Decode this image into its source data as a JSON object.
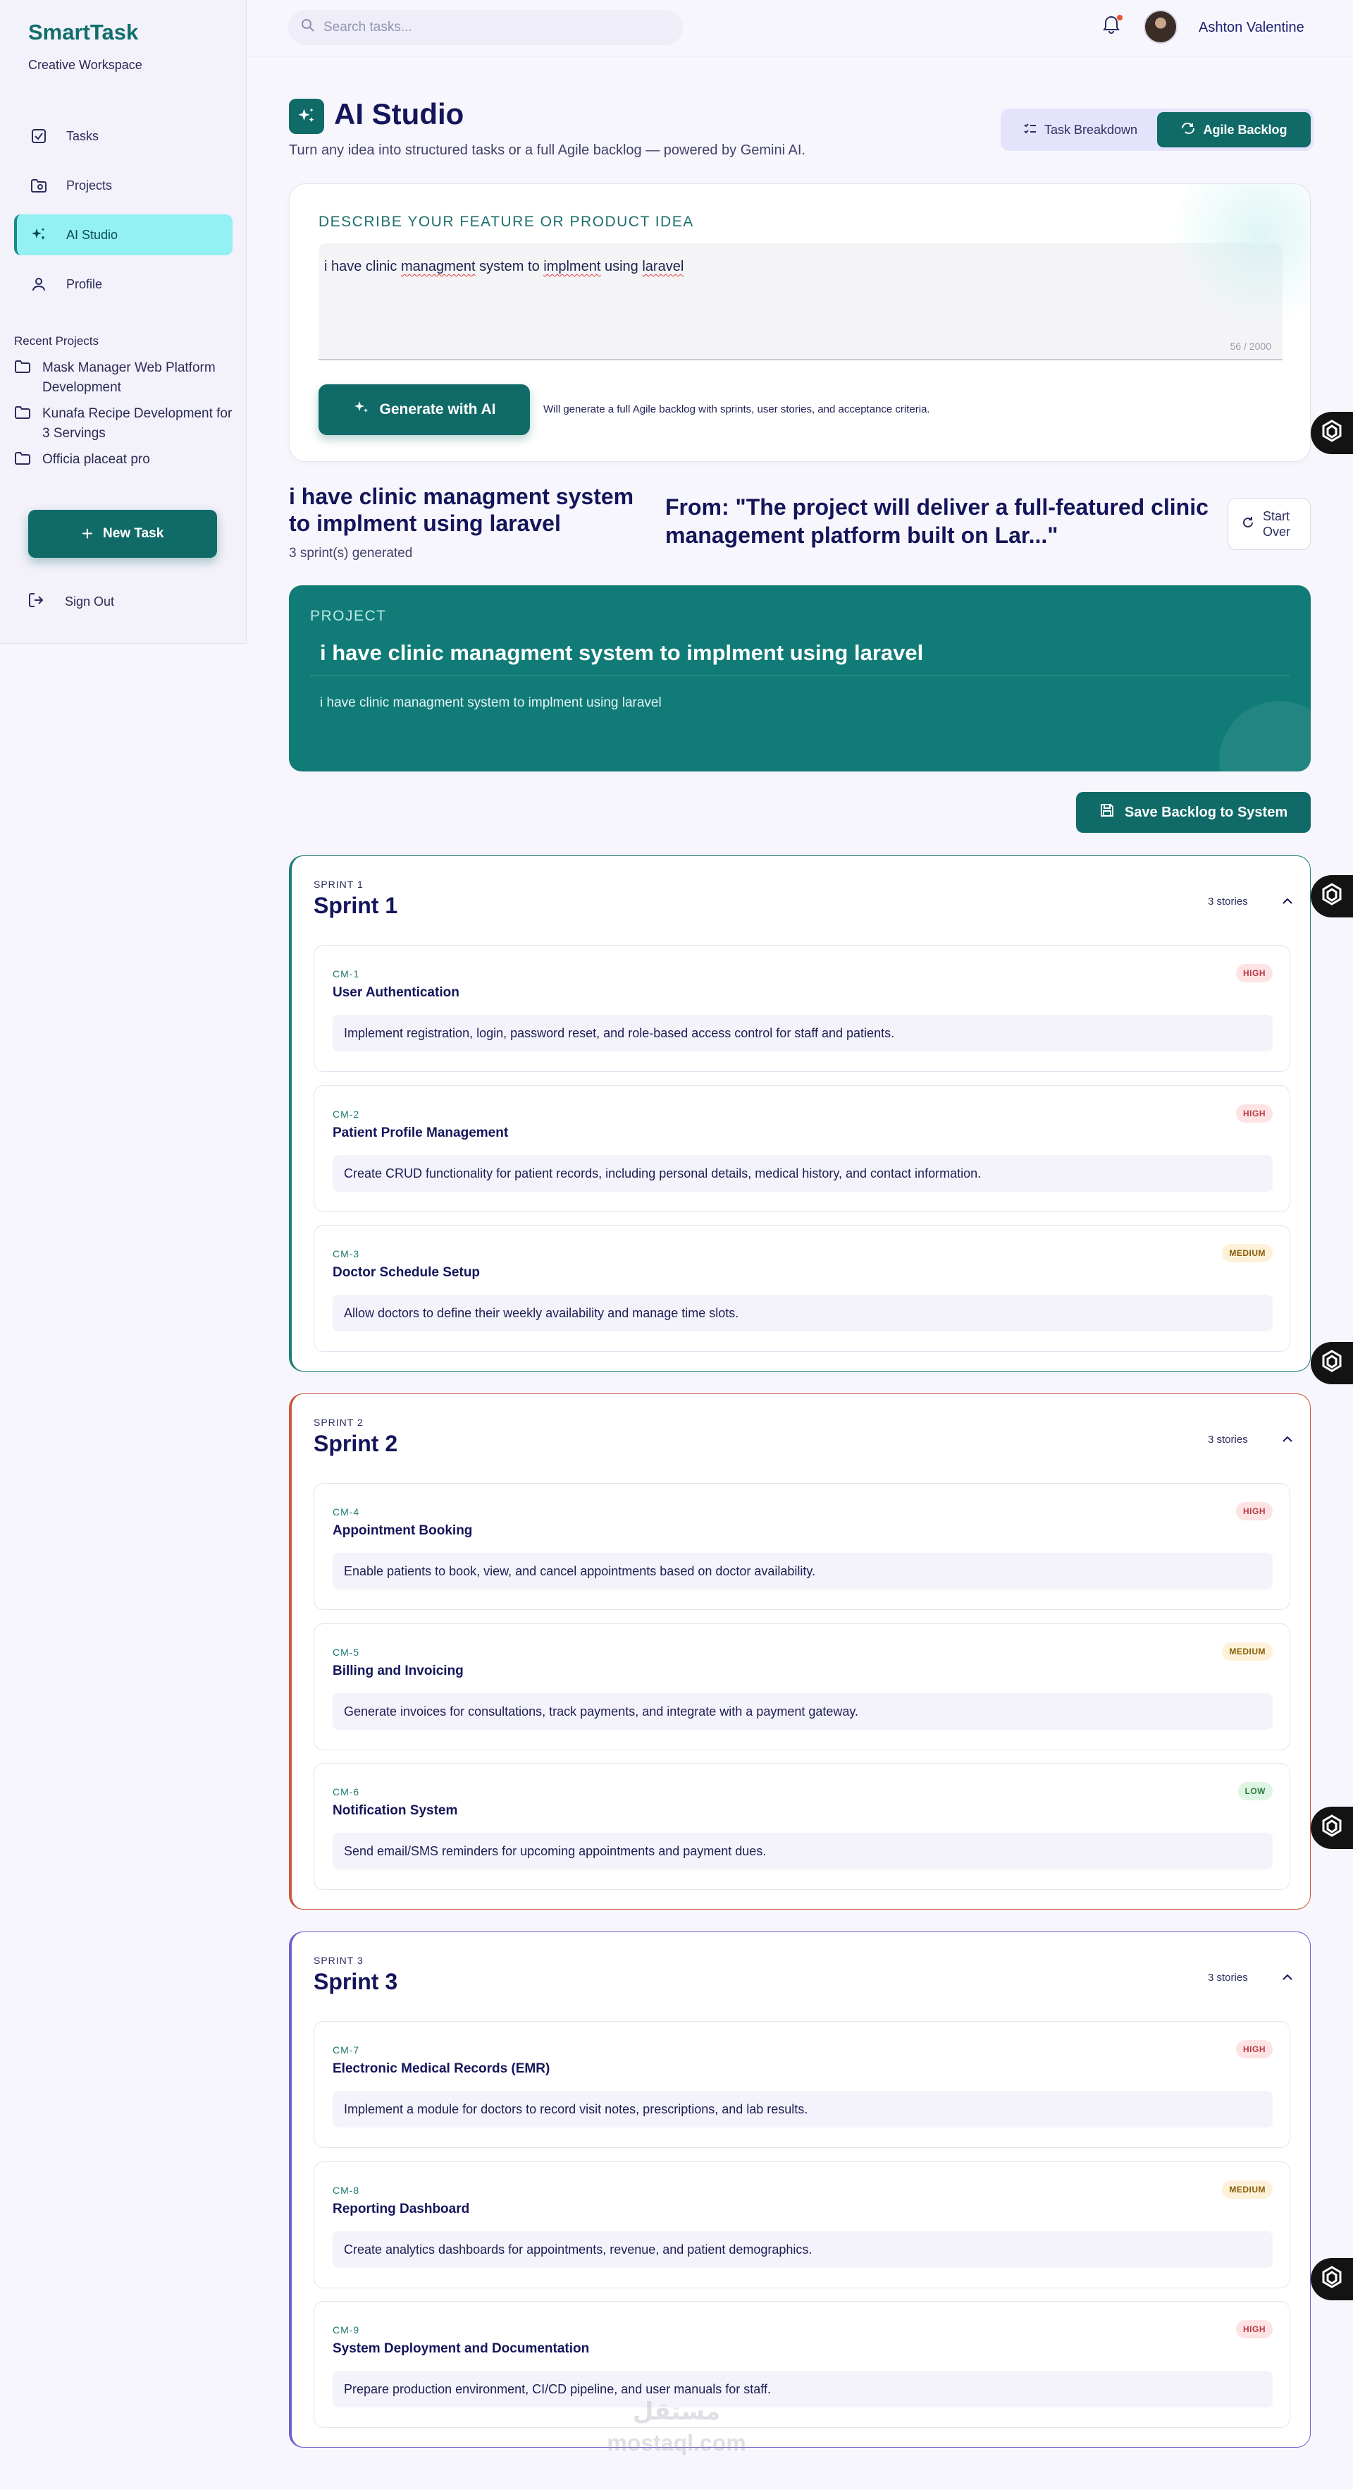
{
  "brand": {
    "name": "SmartTask",
    "subtitle": "Creative Workspace"
  },
  "sidebar": {
    "nav": [
      {
        "label": "Tasks",
        "icon": "task-check-icon",
        "active": false
      },
      {
        "label": "Projects",
        "icon": "folder-icon",
        "active": false
      },
      {
        "label": "AI Studio",
        "icon": "sparkles-icon",
        "active": true
      },
      {
        "label": "Profile",
        "icon": "person-icon",
        "active": false
      }
    ],
    "recent_title": "Recent Projects",
    "recent_projects": [
      "Mask Manager Web Platform Development",
      "Kunafa Recipe Development for 3 Servings",
      "Officia placeat pro"
    ],
    "new_task_label": "New Task",
    "sign_out_label": "Sign Out"
  },
  "topbar": {
    "search_placeholder": "Search tasks...",
    "user_name": "Ashton Valentine"
  },
  "page": {
    "title": "AI Studio",
    "subtitle": "Turn any idea into structured tasks or a full Agile backlog — powered by Gemini AI.",
    "modes": [
      {
        "label": "Task Breakdown",
        "active": false
      },
      {
        "label": "Agile Backlog",
        "active": true
      }
    ]
  },
  "idea": {
    "label": "DESCRIBE YOUR FEATURE OR PRODUCT IDEA",
    "text_parts": [
      "i have clinic ",
      "managment",
      " system to ",
      "implment",
      " using ",
      "laravel"
    ],
    "counter": "56 / 2000",
    "generate_label": "Generate with AI",
    "note": "Will generate a full Agile backlog with sprints, user stories, and acceptance criteria."
  },
  "result": {
    "title": "i have clinic managment system to implment using laravel",
    "count": "3 sprint(s) generated",
    "from": "From: \"The project will deliver a full-featured clinic management platform built on Lar...\"",
    "start_over": "Start Over"
  },
  "project": {
    "label": "PROJECT",
    "name": "i have clinic managment system to implment using laravel",
    "description": "i have clinic managment system to implment using laravel"
  },
  "save_label": "Save Backlog to System",
  "colors": {
    "primary": "#106b68",
    "sprint1": "#1f7f78",
    "sprint2": "#c95a3a",
    "sprint3": "#6b63c9"
  },
  "sprints": [
    {
      "kicker": "SPRINT 1",
      "title": "Sprint 1",
      "count": "3 stories",
      "stories": [
        {
          "id": "CM-1",
          "title": "User Authentication",
          "priority": "HIGH",
          "desc": "Implement registration, login, password reset, and role-based access control for staff and patients."
        },
        {
          "id": "CM-2",
          "title": "Patient Profile Management",
          "priority": "HIGH",
          "desc": "Create CRUD functionality for patient records, including personal details, medical history, and contact information."
        },
        {
          "id": "CM-3",
          "title": "Doctor Schedule Setup",
          "priority": "MEDIUM",
          "desc": "Allow doctors to define their weekly availability and manage time slots."
        }
      ]
    },
    {
      "kicker": "SPRINT 2",
      "title": "Sprint 2",
      "count": "3 stories",
      "stories": [
        {
          "id": "CM-4",
          "title": "Appointment Booking",
          "priority": "HIGH",
          "desc": "Enable patients to book, view, and cancel appointments based on doctor availability."
        },
        {
          "id": "CM-5",
          "title": "Billing and Invoicing",
          "priority": "MEDIUM",
          "desc": "Generate invoices for consultations, track payments, and integrate with a payment gateway."
        },
        {
          "id": "CM-6",
          "title": "Notification System",
          "priority": "LOW",
          "desc": "Send email/SMS reminders for upcoming appointments and payment dues."
        }
      ]
    },
    {
      "kicker": "SPRINT 3",
      "title": "Sprint 3",
      "count": "3 stories",
      "stories": [
        {
          "id": "CM-7",
          "title": "Electronic Medical Records (EMR)",
          "priority": "HIGH",
          "desc": "Implement a module for doctors to record visit notes, prescriptions, and lab results."
        },
        {
          "id": "CM-8",
          "title": "Reporting Dashboard",
          "priority": "MEDIUM",
          "desc": "Create analytics dashboards for appointments, revenue, and patient demographics."
        },
        {
          "id": "CM-9",
          "title": "System Deployment and Documentation",
          "priority": "HIGH",
          "desc": "Prepare production environment, CI/CD pipeline, and user manuals for staff."
        }
      ]
    }
  ],
  "watermark": {
    "line1": "مستقل",
    "line2": "mostaql.com"
  }
}
